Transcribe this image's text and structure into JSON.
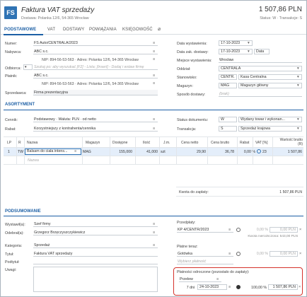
{
  "header": {
    "logo": "FS",
    "title": "Faktura VAT sprzedaży",
    "subtitle": "Dostawa: Polanka 12/6, 54-365 Wrocław",
    "amount": "1 507,86 PLN",
    "status": "Status: W · Transakcje: S"
  },
  "tabs": [
    "PODSTAWOWE",
    "VAT",
    "DOSTAWY",
    "POWIĄZANIA",
    "KSIĘGOWOŚĆ"
  ],
  "left": {
    "numer_label": "Numer:",
    "numer": "FS Auto/CENTRALA/2023",
    "nabywca_label": "Nabywca:",
    "nabywca": "ABC s.c.",
    "nabywca_addr": "NIP: 894-56-53-563 · Adres: Polanka 12/6, 54-365 Wrocław",
    "odbiorca_label": "Odbiorca:",
    "odbiorca_ph": "Szukaj po: aby wyszukać [F2] - Lista; [Insert] - Dodaj i wstaw firmę",
    "platnik_label": "Płatnik:",
    "platnik": "ABC s.c.",
    "platnik_addr": "NIP: 894-56-53-563 · Adres: Polanka 12/6, 54-365 Wrocław",
    "sprzedawca_label": "Sprzedawca:",
    "sprzedawca": "Firma prezentacyjna"
  },
  "right": {
    "data_wyst_label": "Data wystawienia:",
    "data_wyst": "17-10-2023",
    "data_dost_label": "Data zak. dostawy:",
    "data_dost": "17-10-2023",
    "data_dost_type": "Data",
    "miejsce_label": "Miejsce wystawienia:",
    "miejsce": "Wrocław",
    "oddzial_label": "Oddział:",
    "oddzial": "CENTRALA",
    "stanowisko_label": "Stanowisko:",
    "stanowisko_code": "CENTR.",
    "stanowisko": "Kasa Centralna",
    "magazyn_label": "Magazyn:",
    "magazyn_code": "MAG",
    "magazyn": "Magazyn główny",
    "sposob_label": "Sposób dostawy:",
    "sposob_ph": "(brak)"
  },
  "asortyment": {
    "title": "ASORTYMENT",
    "cennik_label": "Cennik:",
    "cennik": "Podstawowy · Waluta: PLN · od netto",
    "rabat_label": "Rabat:",
    "rabat": "Korzystniejszy z kontrahenta/cennika",
    "status_label": "Status dokumentu:",
    "status_code": "W",
    "status": "Wydany towar i wykonan...",
    "transakcja_label": "Transakcja:",
    "transakcja_code": "S",
    "transakcja": "Sprzedaż krajowa"
  },
  "table": {
    "headers": [
      "LP",
      "R",
      "Nazwa",
      "Magazyn",
      "Dostępne",
      "Ilość",
      "J.m.",
      "Cena netto",
      "Cena brutto",
      "Rabat",
      "VAT [%]",
      "Wartość brutto (R)"
    ],
    "row": {
      "lp": "1",
      "r": "TW",
      "nazwa": "Balsam do ciała intens...",
      "magazyn": "MAG",
      "dostepne": "155,000",
      "ilosc": "41,000",
      "jm": "szt",
      "netto": "29,90",
      "brutto": "36,78",
      "rabat": "0,00 %",
      "vat": "23",
      "wartosc": "1 507,86"
    },
    "new_row_ph": "Nazwa",
    "kwota_label": "Kwota do zapłaty:",
    "kwota": "1 507,86 PLN"
  },
  "podsumowanie": {
    "title": "PODSUMOWANIE",
    "wystawil_label": "Wystawił(a):",
    "wystawil": "Szef firmy",
    "odebral_label": "Odebrał(a):",
    "odebral": "Grzegorz Brzęczyszczykiewicz",
    "kategoria_label": "Kategoria:",
    "kategoria": "Sprzedaż",
    "tytul_label": "Tytuł:",
    "tytul": "Faktura VAT sprzedaży",
    "podtytul_label": "Podtytuł:",
    "uwagi_label": "Uwagi:",
    "przedplaty_label": "Przedpłaty:",
    "przedplaty_doc": "KP 4/CENTR/2023",
    "przedplaty_amt": "0,00 PLN",
    "przedplaty_note": "Kwota nierozliczona: 543,00 PLN",
    "teraz_label": "Płatne teraz:",
    "teraz_method": "Gotówka",
    "teraz_amt": "0,00 PLN",
    "teraz_ph": "Wybierz płatność",
    "odroczone_label": "Płatności odroczone (pozostało do zapłaty):",
    "odroczone_method": "Przelew",
    "odroczone_days": "7 dni",
    "odroczone_date": "24-10-2023",
    "odroczone_pct": "100,00 %",
    "odroczone_amt": "1 507,86 PLN"
  }
}
